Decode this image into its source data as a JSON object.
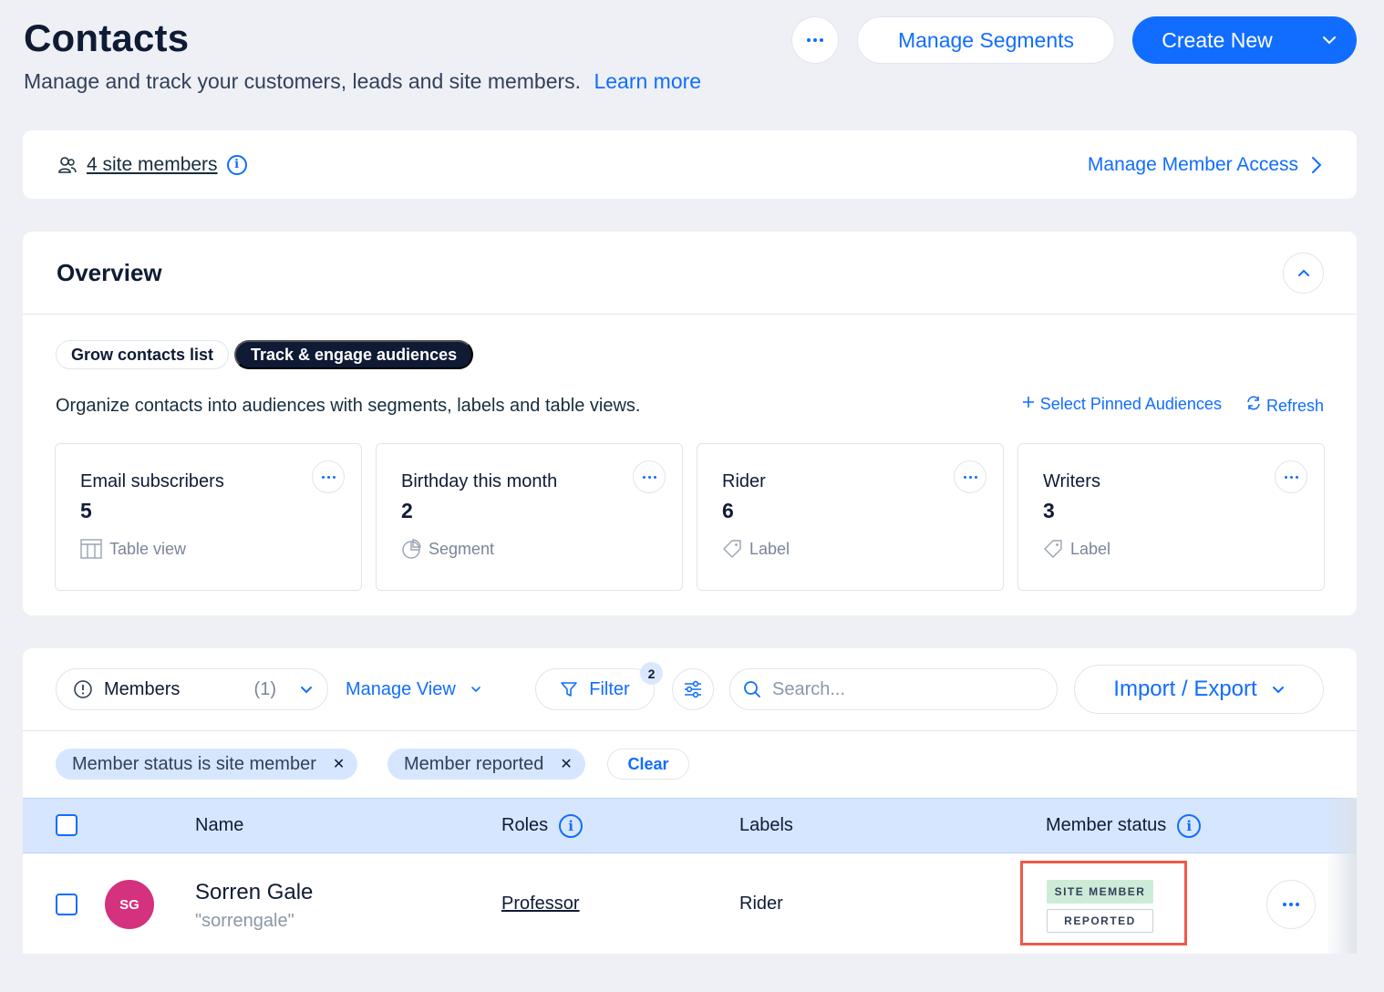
{
  "header": {
    "title": "Contacts",
    "subtitle": "Manage and track your customers, leads and site members.",
    "learn_more": "Learn more",
    "manage_segments": "Manage Segments",
    "create_new": "Create New"
  },
  "members_bar": {
    "count_label": "4 site members",
    "manage_access": "Manage Member Access"
  },
  "overview": {
    "title": "Overview",
    "tabs": [
      {
        "label": "Grow contacts list",
        "active": false
      },
      {
        "label": "Track & engage audiences",
        "active": true
      }
    ],
    "description": "Organize contacts into audiences with segments, labels and table views.",
    "select_pinned": "Select Pinned Audiences",
    "refresh": "Refresh",
    "audiences": [
      {
        "name": "Email subscribers",
        "count": "5",
        "type": "Table view",
        "icon": "table-icon"
      },
      {
        "name": "Birthday this month",
        "count": "2",
        "type": "Segment",
        "icon": "pie-chart-icon"
      },
      {
        "name": "Rider",
        "count": "6",
        "type": "Label",
        "icon": "tag-icon"
      },
      {
        "name": "Writers",
        "count": "3",
        "type": "Label",
        "icon": "tag-icon"
      }
    ]
  },
  "table": {
    "view_name": "Members",
    "view_count": "(1)",
    "manage_view": "Manage View",
    "filter_label": "Filter",
    "filter_count": "2",
    "search_placeholder": "Search...",
    "import_export": "Import / Export",
    "chips": [
      {
        "label": "Member status is site member"
      },
      {
        "label": "Member reported"
      }
    ],
    "clear": "Clear",
    "columns": {
      "name": "Name",
      "roles": "Roles",
      "labels": "Labels",
      "member_status": "Member status"
    },
    "rows": [
      {
        "initials": "SG",
        "name": "Sorren Gale",
        "nickname": "\"sorrengale\"",
        "role": "Professor",
        "label": "Rider",
        "status": "SITE MEMBER",
        "sub_status": "REPORTED"
      }
    ]
  },
  "colors": {
    "accent": "#116dff",
    "avatar": "#d4317f",
    "highlight_box": "#ef5a47",
    "site_member_badge": "#cdecd7"
  }
}
